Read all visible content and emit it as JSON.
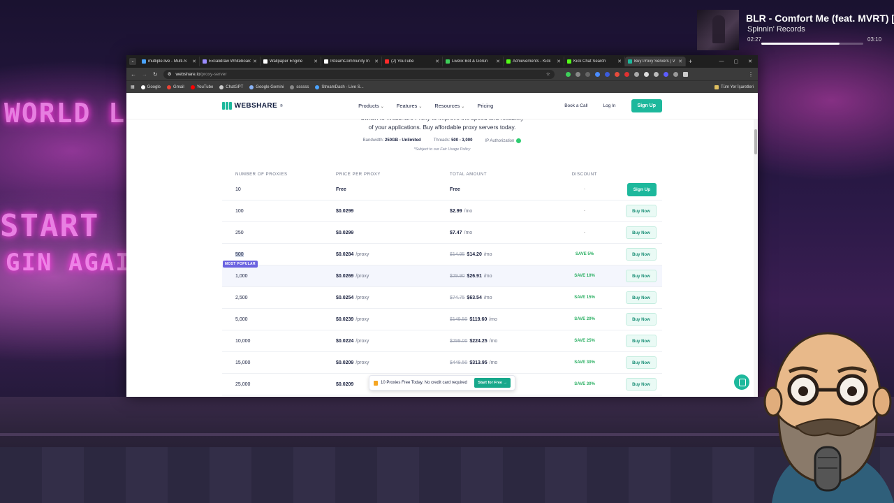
{
  "now_playing": {
    "title": "BLR - Comfort Me (feat. MVRT) [O",
    "artist": "Spinnin' Records",
    "elapsed": "02:27",
    "duration": "03:10",
    "progress_fraction": 0.77
  },
  "background": {
    "sign_top": "WORLD L",
    "sign_mid": "START",
    "sign_low": "GIN AGAIN"
  },
  "browser": {
    "tabs": [
      {
        "label": "mutliple.live - Multi-S",
        "color": "#4aa3ff"
      },
      {
        "label": "Excalidraw Whiteboard",
        "color": "#9b8cff"
      },
      {
        "label": "Wallpaper Engine",
        "color": "#ffffff"
      },
      {
        "label": "ISteamCommunity In",
        "color": "#ffffff"
      },
      {
        "label": "(2) YouTube",
        "color": "#ff2a2a"
      },
      {
        "label": "Livelix Bot & Görün",
        "color": "#3ecf5a"
      },
      {
        "label": "Achievements - Kick",
        "color": "#53fc18"
      },
      {
        "label": "Kick Chat Search",
        "color": "#53fc18"
      },
      {
        "label": "Buy Proxy Servers | V",
        "color": "#1db89c",
        "active": true
      }
    ],
    "url_host": "webshare.io",
    "url_path": "/proxy-server",
    "bookmarks": [
      {
        "label": "Google",
        "color": "#ffffff"
      },
      {
        "label": "Gmail",
        "color": "#ea4335"
      },
      {
        "label": "YouTube",
        "color": "#ff0000"
      },
      {
        "label": "ChatGPT",
        "color": "#cccccc"
      },
      {
        "label": "Google Gemini",
        "color": "#8ab4f8"
      },
      {
        "label": "ssssss",
        "color": "#888888"
      },
      {
        "label": "StreamDash - Live S...",
        "color": "#4aa3ff"
      }
    ],
    "bookmarks_right": "Tüm Yer İşaretleri"
  },
  "site": {
    "logo": "WEBSHARE",
    "logo_reg": "®",
    "menu": [
      "Products",
      "Features",
      "Resources",
      "Pricing"
    ],
    "book_call": "Book a Call",
    "login": "Log In",
    "signup": "Sign Up",
    "hero_line1": "Switch to Webshare Proxy to improve the speed and reliability",
    "hero_line2": "of your applications. Buy affordable proxy servers today.",
    "bandwidth_label": "Bandwidth:",
    "bandwidth_value": "250GB - Unlimited",
    "threads_label": "Threads:",
    "threads_value": "500 - 3,000",
    "ip_auth": "IP Authorization",
    "fair_use": "*Subject to our Fair Usage Policy",
    "headers": [
      "NUMBER OF PROXIES",
      "PRICE PER PROXY",
      "TOTAL AMOUNT",
      "DISCOUNT"
    ],
    "most_popular": "MOST POPULAR",
    "rows": [
      {
        "n": "10",
        "price": "Free",
        "per": "",
        "old": "",
        "total": "Free",
        "mo": "",
        "discount": "-",
        "action": "Sign Up"
      },
      {
        "n": "100",
        "price": "$0.0299",
        "per": "",
        "old": "",
        "total": "$2.99",
        "mo": "/mo",
        "discount": "-",
        "action": "Buy Now"
      },
      {
        "n": "250",
        "price": "$0.0299",
        "per": "",
        "old": "",
        "total": "$7.47",
        "mo": "/mo",
        "discount": "-",
        "action": "Buy Now"
      },
      {
        "n": "500",
        "price": "$0.0284",
        "per": "/proxy",
        "old": "$14.95",
        "total": "$14.20",
        "mo": "/mo",
        "discount": "SAVE 5%",
        "action": "Buy Now"
      },
      {
        "n": "1,000",
        "price": "$0.0269",
        "per": "/proxy",
        "old": "$29.90",
        "total": "$26.91",
        "mo": "/mo",
        "discount": "SAVE 10%",
        "action": "Buy Now"
      },
      {
        "n": "2,500",
        "price": "$0.0254",
        "per": "/proxy",
        "old": "$74.75",
        "total": "$63.54",
        "mo": "/mo",
        "discount": "SAVE 15%",
        "action": "Buy Now"
      },
      {
        "n": "5,000",
        "price": "$0.0239",
        "per": "/proxy",
        "old": "$149.50",
        "total": "$119.60",
        "mo": "/mo",
        "discount": "SAVE 20%",
        "action": "Buy Now"
      },
      {
        "n": "10,000",
        "price": "$0.0224",
        "per": "/proxy",
        "old": "$299.00",
        "total": "$224.25",
        "mo": "/mo",
        "discount": "SAVE 25%",
        "action": "Buy Now"
      },
      {
        "n": "15,000",
        "price": "$0.0209",
        "per": "/proxy",
        "old": "$448.50",
        "total": "$313.95",
        "mo": "/mo",
        "discount": "SAVE 30%",
        "action": "Buy Now"
      },
      {
        "n": "25,000",
        "price": "$0.0209",
        "per": "",
        "old": "",
        "total": "",
        "mo": "",
        "discount": "SAVE 30%",
        "action": "Buy Now"
      }
    ],
    "toast_text": "10 Proxies Free Today. No credit card required",
    "toast_button": "Start for Free →"
  },
  "colors": {
    "brand": "#1db89c",
    "badge": "#6b63e0",
    "save": "#27ae60"
  }
}
